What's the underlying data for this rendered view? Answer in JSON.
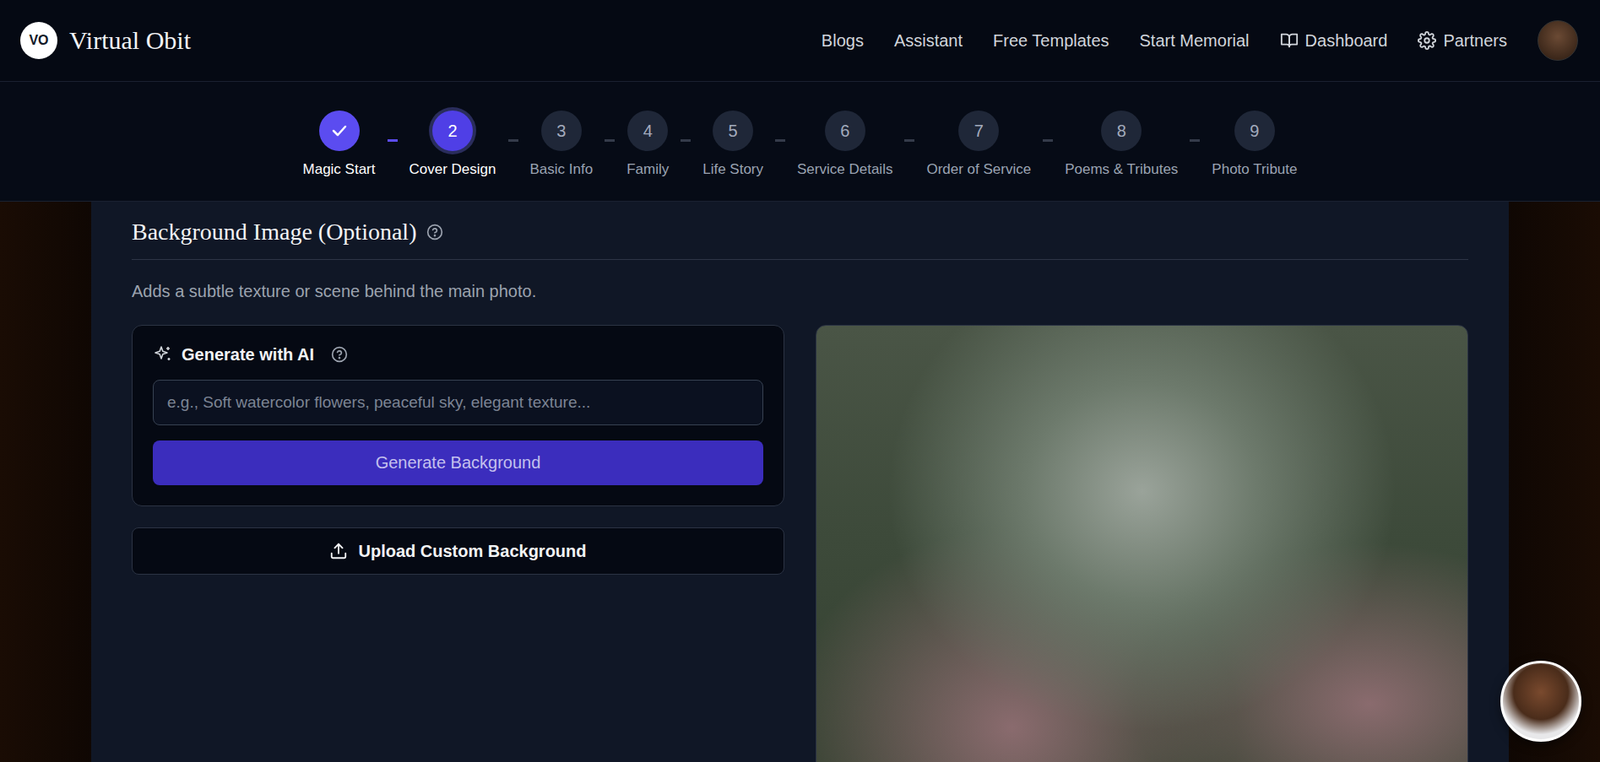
{
  "brand": {
    "logo": "VO",
    "name": "Virtual Obit"
  },
  "nav": [
    "Blogs",
    "Assistant",
    "Free Templates",
    "Start Memorial"
  ],
  "nav_icon_links": [
    "Dashboard",
    "Partners"
  ],
  "steps": [
    {
      "label": "Magic Start",
      "completed": true,
      "selected": false
    },
    {
      "number": "2",
      "label": "Cover Design",
      "completed": false,
      "selected": true
    },
    {
      "number": "3",
      "label": "Basic Info",
      "completed": false,
      "selected": false
    },
    {
      "number": "4",
      "label": "Family",
      "completed": false,
      "selected": false
    },
    {
      "number": "5",
      "label": "Life Story",
      "completed": false,
      "selected": false
    },
    {
      "number": "6",
      "label": "Service Details",
      "completed": false,
      "selected": false
    },
    {
      "number": "7",
      "label": "Order of Service",
      "completed": false,
      "selected": false
    },
    {
      "number": "8",
      "label": "Poems & Tributes",
      "completed": false,
      "selected": false
    },
    {
      "number": "9",
      "label": "Photo Tribute",
      "completed": false,
      "selected": false
    }
  ],
  "section": {
    "title": "Background Image (Optional)",
    "description": "Adds a subtle texture or scene behind the main photo."
  },
  "ai": {
    "title": "Generate with AI",
    "placeholder": "e.g., Soft watercolor flowers, peaceful sky, elegant texture...",
    "button": "Generate Background"
  },
  "upload": {
    "label": "Upload Custom Background"
  }
}
